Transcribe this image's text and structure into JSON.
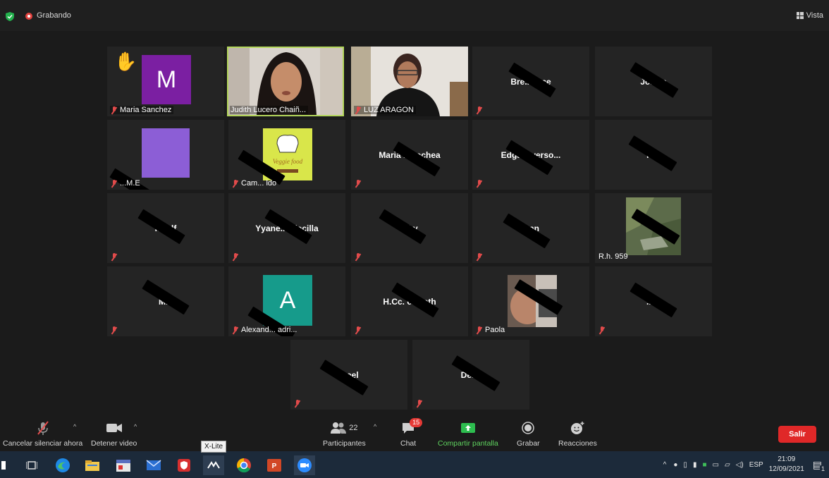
{
  "topbar": {
    "recording_label": "Grabando",
    "view_label": "Vista"
  },
  "participants": [
    {
      "name": "Maria Sanchez",
      "avatar_letter": "M",
      "avatar_color": "#7b1fa2",
      "hand_raised": true,
      "muted": true
    },
    {
      "name": "Judith Lucero Chaiñ...",
      "video": true,
      "active_speaker": true
    },
    {
      "name": "LUZ ARAGON",
      "video": true,
      "muted": true
    },
    {
      "name": "Bre... tece",
      "muted": true
    },
    {
      "name": "Jo... is",
      "muted": true
    },
    {
      "name": "...M.E",
      "avatar_color": "#8c5ed6",
      "muted": true
    },
    {
      "name": "Cam... ldo",
      "has_image": true,
      "image_text": "Veggie food",
      "muted": true
    },
    {
      "name": "Maria ... rochea",
      "muted": true
    },
    {
      "name": "Edga... verso...",
      "muted": true
    },
    {
      "name": "To...",
      "muted": true
    },
    {
      "name": "Is... lf",
      "muted": true
    },
    {
      "name": "Yyane... blecilla",
      "muted": true
    },
    {
      "name": "...ky",
      "muted": true
    },
    {
      "name": "...an",
      "muted": true
    },
    {
      "name": "R.h. 959",
      "has_image": true,
      "muted": true
    },
    {
      "name": "M...",
      "muted": true
    },
    {
      "name": "Alexand... adri...",
      "avatar_letter": "A",
      "avatar_color": "#169b8b",
      "muted": true
    },
    {
      "name": "H.Cc. el... eth",
      "muted": true
    },
    {
      "name": "Paola",
      "has_image": true,
      "muted": true
    },
    {
      "name": "...la",
      "muted": true
    },
    {
      "name": "...oel",
      "muted": true
    },
    {
      "name": "De...l",
      "muted": true
    }
  ],
  "toolbar": {
    "unmute_label": "Cancelar silenciar ahora",
    "stop_video_label": "Detener video",
    "participants_label": "Participantes",
    "participants_count": "22",
    "chat_label": "Chat",
    "chat_badge": "15",
    "share_label": "Compartir pantalla",
    "record_label": "Grabar",
    "reactions_label": "Reacciones",
    "leave_label": "Salir"
  },
  "taskbar": {
    "tooltip": "X-Lite",
    "language": "ESP",
    "time": "21:09",
    "date": "12/09/2021",
    "notification_count": "1"
  },
  "colors": {
    "accent_green": "#5fd35f",
    "leave_red": "#e02828",
    "active_border": "#b3d65b"
  }
}
